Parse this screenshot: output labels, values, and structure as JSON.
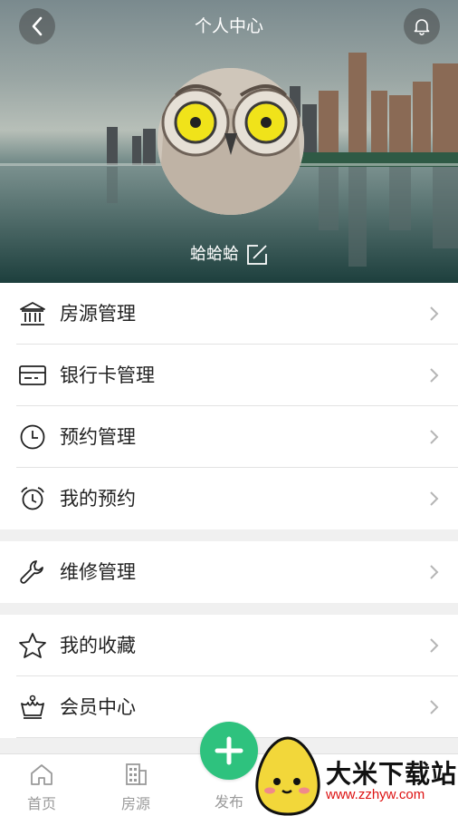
{
  "header": {
    "title": "个人中心",
    "username": "蛤蛤蛤",
    "back_icon": "chevron-left-icon",
    "bell_icon": "bell-icon",
    "edit_icon": "edit-icon"
  },
  "menu": {
    "group1": [
      {
        "label": "房源管理",
        "icon": "building-icon"
      },
      {
        "label": "银行卡管理",
        "icon": "bank-card-icon"
      },
      {
        "label": "预约管理",
        "icon": "clock-icon"
      },
      {
        "label": "我的预约",
        "icon": "alarm-clock-icon"
      }
    ],
    "group2": [
      {
        "label": "维修管理",
        "icon": "wrench-icon"
      }
    ],
    "group3": [
      {
        "label": "我的收藏",
        "icon": "star-icon"
      },
      {
        "label": "会员中心",
        "icon": "crown-icon"
      }
    ]
  },
  "tabbar": {
    "items": [
      {
        "label": "首页",
        "icon": "home-icon"
      },
      {
        "label": "房源",
        "icon": "building-icon"
      },
      {
        "label": "发布",
        "icon": "plus-icon"
      }
    ]
  },
  "watermark": {
    "brand": "大米下载站",
    "url": "www.zzhyw.com"
  },
  "colors": {
    "accent": "#2ec27e",
    "divider": "#e3e3e3",
    "section_gap": "#f0f0f0",
    "tab_label": "#9a9a9a",
    "watermark_url": "#dd1111"
  }
}
